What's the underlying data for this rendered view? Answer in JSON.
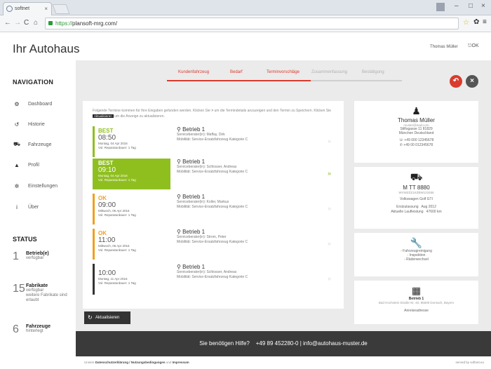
{
  "browser": {
    "tab_title": "softnet",
    "url_https": "https://",
    "url_rest": "plansoft-mrg.com/"
  },
  "site": {
    "title": "Ihr Autohaus",
    "user_name": "Thomas Müller",
    "user_action": "OK"
  },
  "nav": {
    "heading": "NAVIGATION",
    "items": [
      {
        "label": "Dashboard",
        "icon": "car-dashboard-icon"
      },
      {
        "label": "Historie",
        "icon": "history-icon"
      },
      {
        "label": "Fahrzeuge",
        "icon": "car-icon"
      },
      {
        "label": "Profil",
        "icon": "user-icon"
      },
      {
        "label": "Einstellungen",
        "icon": "gear-icon"
      },
      {
        "label": "Über",
        "icon": "info-icon"
      }
    ]
  },
  "status": {
    "heading": "STATUS",
    "items": [
      {
        "num": "1",
        "title": "Betrieb(e)",
        "sub": "verfügbar"
      },
      {
        "num": "15",
        "title": "Fabrikate",
        "sub": "verfügbar",
        "sub2": "weitere Fabrikate sind erlaubt"
      },
      {
        "num": "6",
        "title": "Fahrzeuge",
        "sub": "hinterlegt"
      }
    ]
  },
  "steps": [
    "Kundenfahrzeug",
    "Bedarf",
    "Terminvorschläge",
    "Zusammenfassung",
    "Bestätigung"
  ],
  "intro": {
    "text1": "Folgende Termine kommen für Ihre Eingaben gefunden werden. Klicken Sie",
    "text2": "um die Termindetails anzuzeigen und den Termin zu Speichern. Klicken Sie",
    "kbd": "Aktualisieren",
    "text3": "um die Anzeige zu aktualisieren."
  },
  "appointments": [
    {
      "tag": "BEST",
      "time": "08:50",
      "date": "Montag, 04 Apr 2016",
      "duration": "Vol. Reparaturdauer: 1 Tag",
      "location": "Betrieb 1",
      "advisor": "Serviceberater(in): Maffay, Dirk",
      "mobility": "Mobilität: Service-Ersatzfahrzeug Kategorie C",
      "color": "#8fbf1f"
    },
    {
      "tag": "BEST",
      "time": "09:10",
      "date": "Montag, 04 Apr 2016",
      "duration": "Vol. Reparaturdauer: 1 Tag",
      "location": "Betrieb 1",
      "advisor": "Serviceberater(in): Schlosser, Andreas",
      "mobility": "Mobilität: Service-Ersatzfahrzeug Kategorie C",
      "color": "#8fbf1f"
    },
    {
      "tag": "OK",
      "time": "09:00",
      "date": "Mittwoch, 06 Apr 2016",
      "duration": "Vol. Reparaturdauer: 1 Tag",
      "location": "Betrieb 1",
      "advisor": "Serviceberater(in): Koller, Markus",
      "mobility": "Mobilität: Service-Ersatzfahrzeug Kategorie C",
      "color": "#f0a020"
    },
    {
      "tag": "OK",
      "time": "11:00",
      "date": "Mittwoch, 06 Apr 2016",
      "duration": "Vol. Reparaturdauer: 1 Tag",
      "location": "Betrieb 1",
      "advisor": "Serviceberater(in): Strom, Peter",
      "mobility": "Mobilität: Service-Ersatzfahrzeug Kategorie C",
      "color": "#f0a020"
    },
    {
      "tag": "",
      "time": "10:00",
      "date": "Montag, 11 Apr 2016",
      "duration": "Vol. Reparaturdauer: 1 Tag",
      "location": "Betrieb 1",
      "advisor": "Serviceberater(in): Schlosser, Andreas",
      "mobility": "Mobilität: Service-Ersatzfahrzeug Kategorie C",
      "color": "#333333"
    }
  ],
  "refresh_label": "Aktualisieren",
  "customer": {
    "name": "Thomas Müller",
    "email": "muster@mail.com",
    "street": "Stiftsgasse 11 81829",
    "city": "München Deutschland",
    "phone": "+49 000 12345678",
    "mobile": "+49 00 012345678"
  },
  "vehicle": {
    "plate": "M TT 8880",
    "vin": "WVWZZZ1KZBW123456",
    "model": "Volkswagen Golf GTI",
    "reg_label": "Erstzulassung",
    "reg_value": "Aug 2012",
    "km_label": "Aktuelle Laufleistung",
    "km_value": "47600 km"
  },
  "services": [
    "- Fahrzeugreinigung",
    "- Inspektion",
    "- Räderwechsel"
  ],
  "branch": {
    "name": "Betrieb 1",
    "address": "Bad Hochstein Straße Nr. 40, 85609 Dornach, Bayern",
    "more": "Anreiseadresse"
  },
  "footer": {
    "help": "Sie benötigen Hilfe?",
    "phone": "+49 89 452280-0",
    "email": "info@autohaus-muster.de",
    "legal_prefix": "Unsere",
    "legal_links": "Datenschutzerklärung / Nutzungsbedingungen",
    "legal_and": "und",
    "legal_imprint": "Impressum",
    "powered": "served by softnet.eu"
  },
  "colors": {
    "accent_red": "#d93b2e",
    "best_green": "#8fbf1f",
    "ok_orange": "#f0a020"
  }
}
